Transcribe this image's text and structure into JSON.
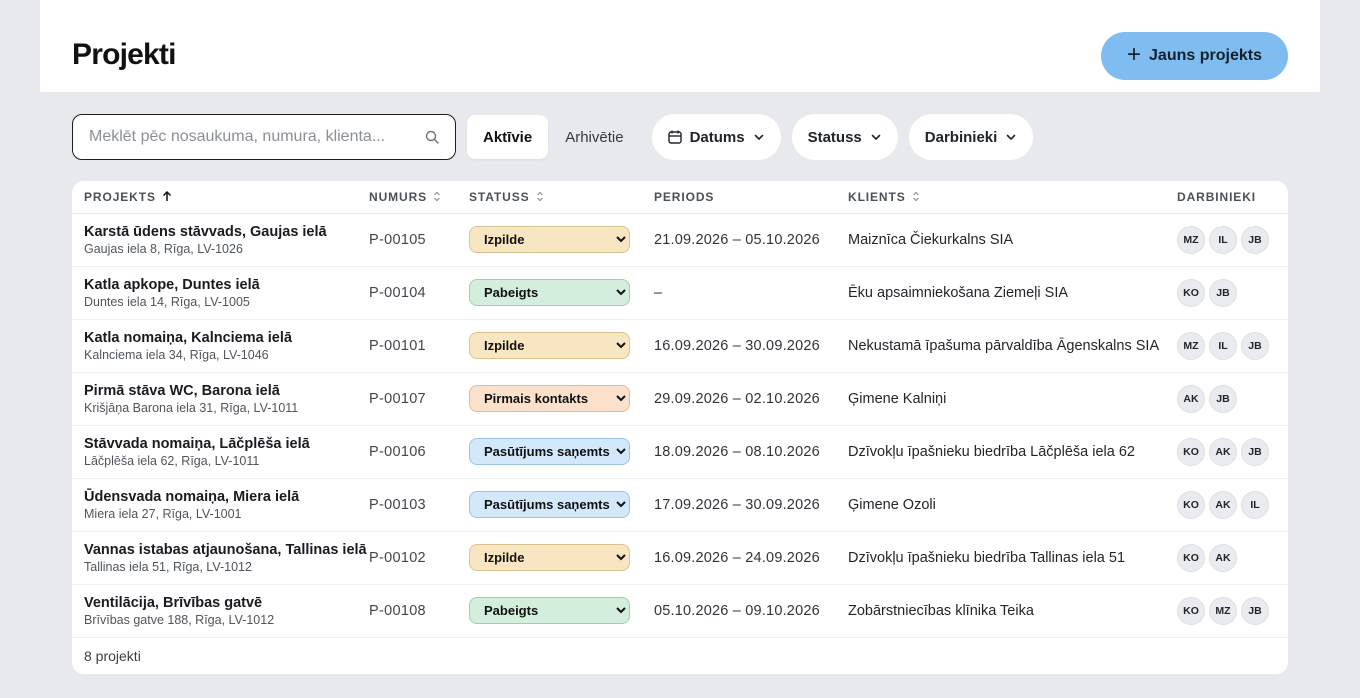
{
  "header": {
    "title": "Projekti",
    "new_button": "Jauns projekts"
  },
  "toolbar": {
    "search_placeholder": "Meklēt pēc nosaukuma, numura, klienta...",
    "tab_active": "Aktīvie",
    "tab_archived": "Arhivētie",
    "filter_date": "Datums",
    "filter_status": "Statuss",
    "filter_staff": "Darbinieki"
  },
  "table": {
    "columns": [
      "PROJEKTS",
      "NUMURS",
      "STATUSS",
      "PERIODS",
      "KLIENTS",
      "DARBINIEKI"
    ],
    "status_options": [
      "Pirmais kontakts",
      "Pasūtījums saņemts",
      "Izpilde",
      "Pabeigts"
    ],
    "status_colors": {
      "Izpilde": "#f7e6c1",
      "Pabeigts": "#d3eedc",
      "Pirmais kontakts": "#fbe1cc",
      "Pasūtījums saņemts": "#d4e8fb"
    },
    "rows": [
      {
        "name": "Karstā ūdens stāvvads, Gaujas ielā",
        "address": "Gaujas iela 8, Rīga, LV-1026",
        "number": "P-00105",
        "status": "Izpilde",
        "period": "21.09.2026 – 05.10.2026",
        "client": "Maiznīca Čiekurkalns SIA",
        "staff": [
          "MZ",
          "IL",
          "JB"
        ]
      },
      {
        "name": "Katla apkope, Duntes ielā",
        "address": "Duntes iela 14, Rīga, LV-1005",
        "number": "P-00104",
        "status": "Pabeigts",
        "period": "–",
        "client": "Ēku apsaimniekošana Ziemeļi SIA",
        "staff": [
          "KO",
          "JB"
        ]
      },
      {
        "name": "Katla nomaiņa, Kalnciema ielā",
        "address": "Kalnciema iela 34, Rīga, LV-1046",
        "number": "P-00101",
        "status": "Izpilde",
        "period": "16.09.2026 – 30.09.2026",
        "client": "Nekustamā īpašuma pārvaldība Āgenskalns SIA",
        "staff": [
          "MZ",
          "IL",
          "JB"
        ]
      },
      {
        "name": "Pirmā stāva WC, Barona ielā",
        "address": "Krišjāņa Barona iela 31, Rīga, LV-1011",
        "number": "P-00107",
        "status": "Pirmais kontakts",
        "period": "29.09.2026 – 02.10.2026",
        "client": "Ģimene Kalniņi",
        "staff": [
          "AK",
          "JB"
        ]
      },
      {
        "name": "Stāvvada nomaiņa, Lāčplēša ielā",
        "address": "Lāčplēša iela 62, Rīga, LV-1011",
        "number": "P-00106",
        "status": "Pasūtījums saņemts",
        "period": "18.09.2026 – 08.10.2026",
        "client": "Dzīvokļu īpašnieku biedrība Lāčplēša iela 62",
        "staff": [
          "KO",
          "AK",
          "JB"
        ]
      },
      {
        "name": "Ūdensvada nomaiņa, Miera ielā",
        "address": "Miera iela 27, Rīga, LV-1001",
        "number": "P-00103",
        "status": "Pasūtījums saņemts",
        "period": "17.09.2026 – 30.09.2026",
        "client": "Ģimene Ozoli",
        "staff": [
          "KO",
          "AK",
          "IL"
        ]
      },
      {
        "name": "Vannas istabas atjaunošana, Tallinas ielā",
        "address": "Tallinas iela 51, Rīga, LV-1012",
        "number": "P-00102",
        "status": "Izpilde",
        "period": "16.09.2026 – 24.09.2026",
        "client": "Dzīvokļu īpašnieku biedrība Tallinas iela 51",
        "staff": [
          "KO",
          "AK"
        ]
      },
      {
        "name": "Ventilācija, Brīvības gatvē",
        "address": "Brīvības gatve 188, Rīga, LV-1012",
        "number": "P-00108",
        "status": "Pabeigts",
        "period": "05.10.2026 – 09.10.2026",
        "client": "Zobārstniecības klīnika Teika",
        "staff": [
          "KO",
          "MZ",
          "JB"
        ]
      }
    ],
    "footer": "8 projekti"
  }
}
